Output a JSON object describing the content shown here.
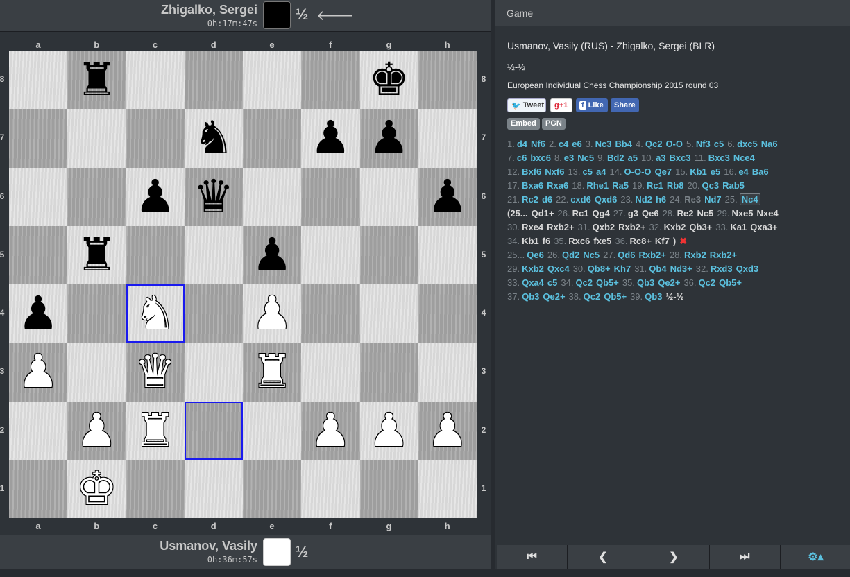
{
  "top_player": {
    "name": "Zhigalko, Sergei",
    "clock": "0h:17m:47s",
    "result": "½",
    "arrow": "🡐"
  },
  "bottom_player": {
    "name": "Usmanov, Vasily",
    "clock": "0h:36m:57s",
    "result": "½"
  },
  "files": [
    "a",
    "b",
    "c",
    "d",
    "e",
    "f",
    "g",
    "h"
  ],
  "ranks": [
    "8",
    "7",
    "6",
    "5",
    "4",
    "3",
    "2",
    "1"
  ],
  "pieces": [
    {
      "sq": "b8",
      "glyph": "♜",
      "color": "b"
    },
    {
      "sq": "g8",
      "glyph": "♚",
      "color": "b"
    },
    {
      "sq": "d7",
      "glyph": "♞",
      "color": "b"
    },
    {
      "sq": "f7",
      "glyph": "♟",
      "color": "b"
    },
    {
      "sq": "g7",
      "glyph": "♟",
      "color": "b"
    },
    {
      "sq": "c6",
      "glyph": "♟",
      "color": "b"
    },
    {
      "sq": "d6",
      "glyph": "♛",
      "color": "b"
    },
    {
      "sq": "h6",
      "glyph": "♟",
      "color": "b"
    },
    {
      "sq": "b5",
      "glyph": "♜",
      "color": "b"
    },
    {
      "sq": "e5",
      "glyph": "♟",
      "color": "b"
    },
    {
      "sq": "a4",
      "glyph": "♟",
      "color": "b"
    },
    {
      "sq": "c4",
      "glyph": "♞",
      "color": "w"
    },
    {
      "sq": "e4",
      "glyph": "♟",
      "color": "w"
    },
    {
      "sq": "a3",
      "glyph": "♟",
      "color": "w"
    },
    {
      "sq": "c3",
      "glyph": "♛",
      "color": "w"
    },
    {
      "sq": "e3",
      "glyph": "♜",
      "color": "w"
    },
    {
      "sq": "b2",
      "glyph": "♟",
      "color": "w"
    },
    {
      "sq": "c2",
      "glyph": "♜",
      "color": "w"
    },
    {
      "sq": "f2",
      "glyph": "♟",
      "color": "w"
    },
    {
      "sq": "g2",
      "glyph": "♟",
      "color": "w"
    },
    {
      "sq": "h2",
      "glyph": "♟",
      "color": "w"
    },
    {
      "sq": "b1",
      "glyph": "♚",
      "color": "w"
    }
  ],
  "highlights": [
    "c4",
    "d2"
  ],
  "game": {
    "header": "Game",
    "players": "Usmanov, Vasily (RUS) - Zhigalko, Sergei (BLR)",
    "result": "½-½",
    "event": "European Individual Chess Championship 2015",
    "round": "round 03",
    "share": {
      "tweet": "Tweet",
      "gplus": "g+1",
      "like": "Like",
      "share": "Share"
    },
    "embed": "Embed",
    "pgn": "PGN"
  },
  "move_lines": [
    [
      [
        "n",
        "1."
      ],
      [
        "m",
        "d4"
      ],
      [
        "m",
        "Nf6"
      ],
      [
        "n",
        "2."
      ],
      [
        "m",
        "c4"
      ],
      [
        "m",
        "e6"
      ],
      [
        "n",
        "3."
      ],
      [
        "m",
        "Nc3"
      ],
      [
        "m",
        "Bb4"
      ],
      [
        "n",
        "4."
      ],
      [
        "m",
        "Qc2"
      ],
      [
        "m",
        "O-O"
      ],
      [
        "n",
        "5."
      ],
      [
        "m",
        "Nf3"
      ],
      [
        "m",
        "c5"
      ],
      [
        "n",
        "6."
      ],
      [
        "m",
        "dxc5"
      ],
      [
        "m",
        "Na6"
      ]
    ],
    [
      [
        "n",
        "7."
      ],
      [
        "m",
        "c6"
      ],
      [
        "m",
        "bxc6"
      ],
      [
        "n",
        "8."
      ],
      [
        "m",
        "e3"
      ],
      [
        "m",
        "Nc5"
      ],
      [
        "n",
        "9."
      ],
      [
        "m",
        "Bd2"
      ],
      [
        "m",
        "a5"
      ],
      [
        "n",
        "10."
      ],
      [
        "m",
        "a3"
      ],
      [
        "m",
        "Bxc3"
      ],
      [
        "n",
        "11."
      ],
      [
        "m",
        "Bxc3"
      ],
      [
        "m",
        "Nce4"
      ]
    ],
    [
      [
        "n",
        "12."
      ],
      [
        "m",
        "Bxf6"
      ],
      [
        "m",
        "Nxf6"
      ],
      [
        "n",
        "13."
      ],
      [
        "m",
        "c5"
      ],
      [
        "m",
        "a4"
      ],
      [
        "n",
        "14."
      ],
      [
        "m",
        "O-O-O"
      ],
      [
        "m",
        "Qe7"
      ],
      [
        "n",
        "15."
      ],
      [
        "m",
        "Kb1"
      ],
      [
        "m",
        "e5"
      ],
      [
        "n",
        "16."
      ],
      [
        "m",
        "e4"
      ],
      [
        "m",
        "Ba6"
      ]
    ],
    [
      [
        "n",
        "17."
      ],
      [
        "m",
        "Bxa6"
      ],
      [
        "m",
        "Rxa6"
      ],
      [
        "n",
        "18."
      ],
      [
        "m",
        "Rhe1"
      ],
      [
        "m",
        "Ra5"
      ],
      [
        "n",
        "19."
      ],
      [
        "m",
        "Rc1"
      ],
      [
        "m",
        "Rb8"
      ],
      [
        "n",
        "20."
      ],
      [
        "m",
        "Qc3"
      ],
      [
        "m",
        "Rab5"
      ]
    ],
    [
      [
        "n",
        "21."
      ],
      [
        "m",
        "Rc2"
      ],
      [
        "m",
        "d6"
      ],
      [
        "n",
        "22."
      ],
      [
        "m",
        "cxd6"
      ],
      [
        "m",
        "Qxd6"
      ],
      [
        "n",
        "23."
      ],
      [
        "m",
        "Nd2"
      ],
      [
        "m",
        "h6"
      ],
      [
        "n",
        "24."
      ],
      [
        "g",
        "Re3"
      ],
      [
        "m",
        "Nd7"
      ],
      [
        "n",
        "25."
      ],
      [
        "c",
        "Nc4"
      ]
    ],
    [
      [
        "v",
        "(25..."
      ],
      [
        "v",
        "Qd1+"
      ],
      [
        "n",
        "26."
      ],
      [
        "v",
        "Rc1"
      ],
      [
        "v",
        "Qg4"
      ],
      [
        "n",
        "27."
      ],
      [
        "v",
        "g3"
      ],
      [
        "v",
        "Qe6"
      ],
      [
        "n",
        "28."
      ],
      [
        "v",
        "Re2"
      ],
      [
        "v",
        "Nc5"
      ],
      [
        "n",
        "29."
      ],
      [
        "v",
        "Nxe5"
      ],
      [
        "v",
        "Nxe4"
      ]
    ],
    [
      [
        "n",
        "30."
      ],
      [
        "v",
        "Rxe4"
      ],
      [
        "v",
        "Rxb2+"
      ],
      [
        "n",
        "31."
      ],
      [
        "v",
        "Qxb2"
      ],
      [
        "v",
        "Rxb2+"
      ],
      [
        "n",
        "32."
      ],
      [
        "v",
        "Kxb2"
      ],
      [
        "v",
        "Qb3+"
      ],
      [
        "n",
        "33."
      ],
      [
        "v",
        "Ka1"
      ],
      [
        "v",
        "Qxa3+"
      ]
    ],
    [
      [
        "n",
        "34."
      ],
      [
        "v",
        "Kb1"
      ],
      [
        "v",
        "f6"
      ],
      [
        "n",
        "35."
      ],
      [
        "v",
        "Rxc6"
      ],
      [
        "v",
        "fxe5"
      ],
      [
        "n",
        "36."
      ],
      [
        "v",
        "Rc8+"
      ],
      [
        "v",
        "Kf7"
      ],
      [
        "v",
        ")"
      ],
      [
        "x",
        "✖"
      ]
    ],
    [
      [
        "n",
        "25..."
      ],
      [
        "m",
        "Qe6"
      ],
      [
        "n",
        "26."
      ],
      [
        "m",
        "Qd2"
      ],
      [
        "m",
        "Nc5"
      ],
      [
        "n",
        "27."
      ],
      [
        "m",
        "Qd6"
      ],
      [
        "m",
        "Rxb2+"
      ],
      [
        "n",
        "28."
      ],
      [
        "m",
        "Rxb2"
      ],
      [
        "m",
        "Rxb2+"
      ]
    ],
    [
      [
        "n",
        "29."
      ],
      [
        "m",
        "Kxb2"
      ],
      [
        "m",
        "Qxc4"
      ],
      [
        "n",
        "30."
      ],
      [
        "m",
        "Qb8+"
      ],
      [
        "m",
        "Kh7"
      ],
      [
        "n",
        "31."
      ],
      [
        "m",
        "Qb4"
      ],
      [
        "m",
        "Nd3+"
      ],
      [
        "n",
        "32."
      ],
      [
        "m",
        "Rxd3"
      ],
      [
        "m",
        "Qxd3"
      ]
    ],
    [
      [
        "n",
        "33."
      ],
      [
        "m",
        "Qxa4"
      ],
      [
        "m",
        "c5"
      ],
      [
        "n",
        "34."
      ],
      [
        "m",
        "Qc2"
      ],
      [
        "m",
        "Qb5+"
      ],
      [
        "n",
        "35."
      ],
      [
        "m",
        "Qb3"
      ],
      [
        "m",
        "Qe2+"
      ],
      [
        "n",
        "36."
      ],
      [
        "m",
        "Qc2"
      ],
      [
        "m",
        "Qb5+"
      ]
    ],
    [
      [
        "n",
        "37."
      ],
      [
        "m",
        "Qb3"
      ],
      [
        "m",
        "Qe2+"
      ],
      [
        "n",
        "38."
      ],
      [
        "m",
        "Qc2"
      ],
      [
        "m",
        "Qb5+"
      ],
      [
        "n",
        "39."
      ],
      [
        "m",
        "Qb3"
      ],
      [
        "r",
        "½-½"
      ]
    ]
  ],
  "nav": {
    "first": "⏮",
    "prev": "❮",
    "next": "❯",
    "last": "⏭",
    "settings": "⚙▴"
  }
}
